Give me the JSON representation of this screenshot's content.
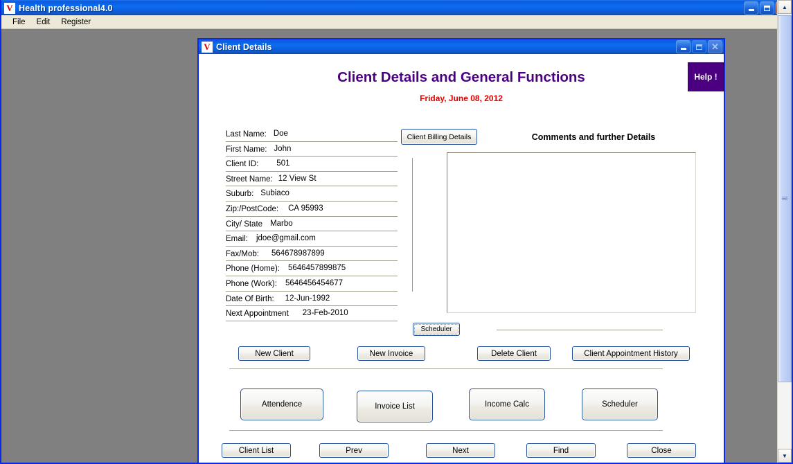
{
  "main_window": {
    "title": "Health professional4.0",
    "icon": "app-logo-icon",
    "controls": {
      "minimize": "–",
      "maximize": "□",
      "close": "✕"
    },
    "menu": [
      "File",
      "Edit",
      "Register"
    ]
  },
  "child_window": {
    "title": "Client Details",
    "icon": "app-logo-icon",
    "controls": {
      "minimize": "–",
      "maximize": "□",
      "close": "✕"
    }
  },
  "header": {
    "title": "Client Details and General Functions",
    "date": "Friday, June 08, 2012",
    "help_label": "Help !",
    "title_color": "#4B0082",
    "date_color": "#E00000"
  },
  "form": {
    "fields": [
      {
        "label": "Last Name:",
        "value": "Doe"
      },
      {
        "label": "First Name:",
        "value": "John"
      },
      {
        "label": "Client ID:",
        "value": "501"
      },
      {
        "label": "Street Name:",
        "value": "12 View St"
      },
      {
        "label": "Suburb:",
        "value": "Subiaco"
      },
      {
        "label": "Zip:/PostCode:",
        "value": "CA 95993"
      },
      {
        "label": "City/ State",
        "value": "Marbo"
      },
      {
        "label": "Email:",
        "value": "jdoe@gmail.com"
      },
      {
        "label": "Fax/Mob:",
        "value": "564678987899"
      },
      {
        "label": "Phone (Home):",
        "value": "5646457899875"
      },
      {
        "label": "Phone (Work):",
        "value": "5646456454677"
      },
      {
        "label": "Date Of Birth:",
        "value": "12-Jun-1992"
      },
      {
        "label": "Next Appointment",
        "value": "23-Feb-2010"
      }
    ]
  },
  "right_panel": {
    "billing_button": "Client Billing Details",
    "comments_label": "Comments and further Details",
    "comments_value": "",
    "comments_placeholder": "",
    "scheduler_small_button": "Scheduler"
  },
  "action_buttons": [
    {
      "label": "New Client"
    },
    {
      "label": "New Invoice"
    },
    {
      "label": "Delete Client"
    },
    {
      "label": "Client Appointment History"
    }
  ],
  "feature_buttons": [
    {
      "label": "Attendence"
    },
    {
      "label": "Invoice List"
    },
    {
      "label": "Income Calc"
    },
    {
      "label": "Scheduler"
    }
  ],
  "nav_buttons": [
    {
      "label": "Client List"
    },
    {
      "label": "Prev"
    },
    {
      "label": "Next"
    },
    {
      "label": "Find"
    },
    {
      "label": "Close"
    }
  ],
  "scrollbar": {
    "up": "▲",
    "down": "▼"
  }
}
